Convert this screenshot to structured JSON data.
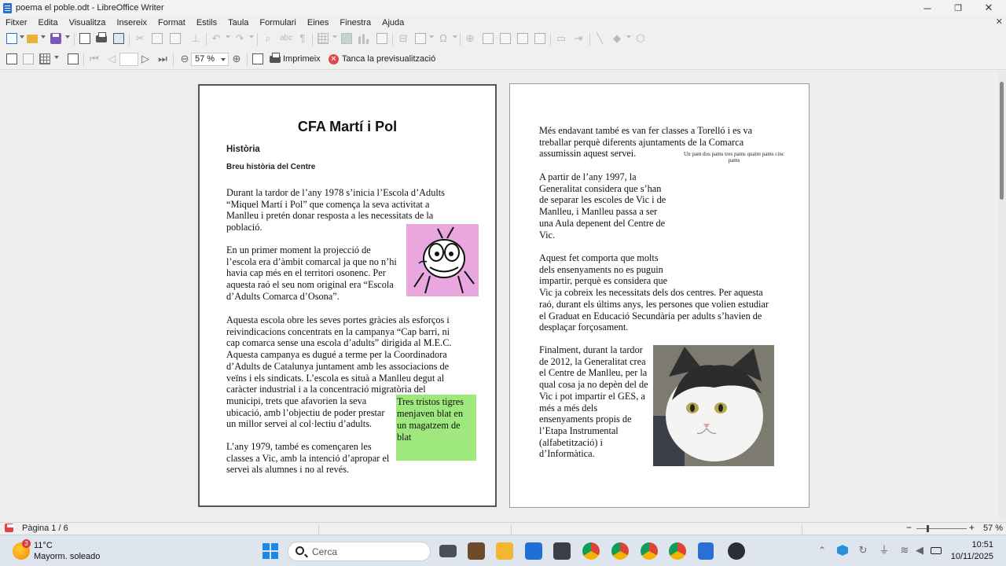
{
  "window": {
    "title": "poema el poble.odt - LibreOffice Writer",
    "controls": {
      "minimize": "─",
      "maximize": "❐",
      "close": "✕"
    }
  },
  "menubar": {
    "items": [
      "Fitxer",
      "Edita",
      "Visualitza",
      "Insereix",
      "Format",
      "Estils",
      "Taula",
      "Formulari",
      "Eines",
      "Finestra",
      "Ajuda"
    ],
    "close_document": "✕"
  },
  "preview_toolbar": {
    "zoom_value": "57 %",
    "print_label": "Imprimeix",
    "close_preview_label": "Tanca la previsualització"
  },
  "page1": {
    "title": "CFA Martí i Pol",
    "heading": "Història",
    "subheading": "Breu història del Centre",
    "paragraphs": [
      [
        "Durant la tardor de l’any 1978 s’inicia l’Escola d’Adults",
        "“Miquel Martí i Pol” que comença la seva activitat a",
        "Manlleu i pretén donar resposta a les necessitats de la",
        "població."
      ],
      [
        "En un primer moment la projecció de",
        "l’escola era d’àmbit comarcal ja que no n’hi",
        "havia cap més en el territori osonenc. Per",
        "aquesta raó el seu nom original era “Escola",
        "d’Adults Comarca d’Osona”."
      ],
      [
        "Aquesta escola obre les seves portes gràcies als esforços i",
        "reivindicacions concentrats en la campanya “Cap barri, ni",
        "cap comarca sense una escola d’adults” dirigida al M.E.C.",
        "Aquesta campanya es dugué a terme per la Coordinadora",
        "d’Adults de Catalunya juntament amb les associacions de",
        "veïns i els sindicats. L’escola es situà a Manlleu degut al",
        "caràcter industrial i a la concentració migratòria del",
        "municipi, trets que afavorien la seva",
        "ubicació, amb l’objectiu de poder prestar",
        "un millor servei al col·lectiu d’adults."
      ],
      [
        "L’any 1979, també es començaren les",
        "classes a Vic, amb la intenció d’apropar el",
        "servei als alumnes i no al revés."
      ]
    ],
    "sticky_note_lines": [
      "Tres tristos tigres",
      "menjaven blat en",
      "un magatzem de",
      "blat"
    ]
  },
  "page2": {
    "paragraphs": [
      [
        "Més endavant també es van fer classes a Torelló i es va",
        "treballar perquè diferents ajuntaments de la Comarca",
        "assumissin aquest servei."
      ],
      [
        "A partir de l’any 1997, la",
        "Generalitat considera que s’han",
        "de separar les escoles de Vic i de",
        "Manlleu, i Manlleu passa a ser",
        "una Aula depenent del Centre de",
        "Vic."
      ],
      [
        "Aquest fet comporta que molts",
        "dels ensenyaments no es puguin",
        "impartir, perquè es considera que",
        "Vic ja cobreix les necessitats dels dos centres. Per aquesta",
        "raó,  durant els últims anys, les persones que volien estudiar",
        "el Graduat en Educació Secundària per adults s’havien de",
        "desplaçar forçosament."
      ],
      [
        "Finalment, durant la tardor",
        "de 2012, la Generalitat crea",
        "el Centre de Manlleu, per la",
        "qual cosa ja no depèn del de",
        "Vic i pot impartir el GES, a",
        "més a més dels",
        "ensenyaments propis de",
        "l’Etapa Instrumental",
        "(alfabetització) i",
        "d’Informàtica."
      ]
    ],
    "small_caption": [
      "Un pam dos pams tres pams quatre pams cinc",
      "pams"
    ]
  },
  "statusbar": {
    "page_info": "Pàgina 1 / 6",
    "zoom_percent": "57 %"
  },
  "taskbar": {
    "weather_temp": "11°C",
    "weather_desc": "Mayorm. soleado",
    "weather_badge": "3",
    "search_placeholder": "Cerca",
    "time": "10:51",
    "date": "10/11/2025"
  },
  "colors": {
    "sticky_note": "#9ee87e",
    "cartoon_background": "#e9a6df",
    "close_preview": "#e04848",
    "start_blue": "#1e88e5"
  }
}
